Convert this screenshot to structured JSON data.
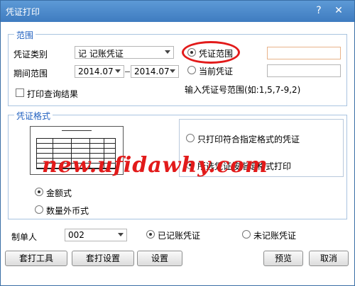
{
  "window": {
    "title": "凭证打印",
    "help_glyph": "?",
    "close_glyph": "✕"
  },
  "range": {
    "legend": "范围",
    "voucher_type_label": "凭证类别",
    "voucher_type_value": "记 记账凭证",
    "period_label": "期间范围",
    "period_from": "2014.07",
    "period_to": "2014.07",
    "print_query_label": "打印查询结果",
    "voucher_range_label": "凭证范围",
    "current_voucher_label": "当前凭证",
    "hint": "输入凭证号范围(如:1,5,7-9,2)"
  },
  "format": {
    "legend": "凭证格式",
    "only_matching_label": "只打印符合指定格式的凭证",
    "by_format_label": "所选凭证按指定格式打印",
    "amount_label": "金额式",
    "foreign_qty_label": "数量外币式"
  },
  "maker": {
    "label": "制单人",
    "value": "002"
  },
  "posting": {
    "posted_label": "已记账凭证",
    "unposted_label": "未记账凭证"
  },
  "buttons": {
    "print_tool": "套打工具",
    "print_setup": "套打设置",
    "settings": "设置",
    "preview": "预览",
    "cancel": "取消"
  },
  "watermark_text": "new.ufidawhy.com",
  "colors": {
    "highlight": "#e21a1a",
    "titlebar": "#4a89cc",
    "legend": "#1f5fbf"
  }
}
